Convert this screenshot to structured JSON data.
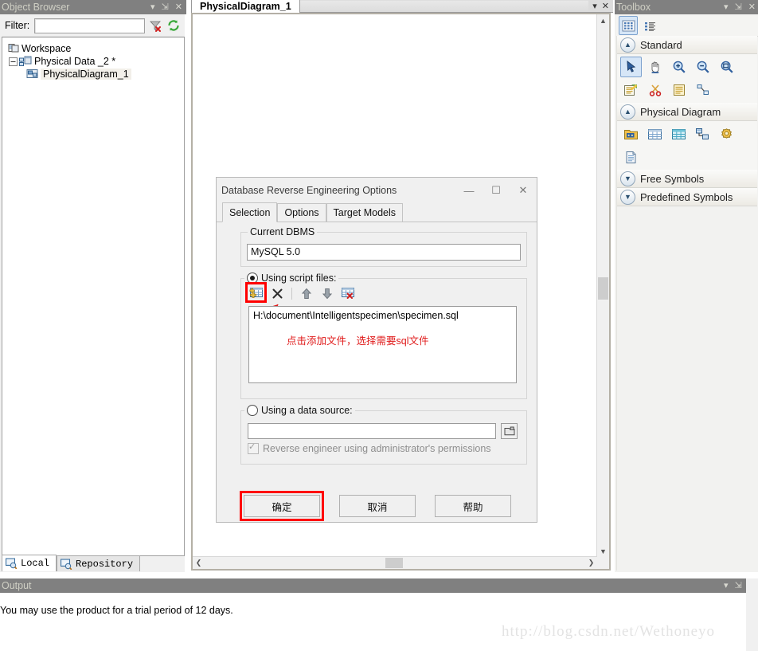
{
  "object_browser": {
    "title": "Object Browser",
    "header_buttons": [
      "dropdown-icon",
      "pin-icon",
      "close-icon"
    ],
    "filter_label": "Filter:",
    "filter_value": "",
    "filter_placeholder": "",
    "clear_filter_icon": "clear-filter-icon",
    "refresh_icon": "refresh-icon",
    "tree": [
      {
        "label": "Workspace",
        "icon": "workspace-icon",
        "depth": 0,
        "selected": false
      },
      {
        "label": "Physical Data _2 *",
        "icon": "model-icon",
        "depth": 1,
        "selected": false
      },
      {
        "label": "PhysicalDiagram_1",
        "icon": "diagram-icon",
        "depth": 2,
        "selected": true
      }
    ],
    "tabs": [
      {
        "label": "Local",
        "icon": "local-icon",
        "active": true
      },
      {
        "label": "Repository",
        "icon": "repository-icon",
        "active": false
      }
    ]
  },
  "diagram_area": {
    "tab_label": "PhysicalDiagram_1",
    "tab_buttons": [
      "tab-list-icon",
      "close-icon"
    ],
    "scroll": {
      "v_up": "▲",
      "v_down": "▼",
      "h_left": "❮",
      "h_right": "❯"
    }
  },
  "toolbox": {
    "title": "Toolbox",
    "header_buttons": [
      "dropdown-icon",
      "pin-icon",
      "close-icon"
    ],
    "view_modes": [
      {
        "name": "grid-view-icon",
        "active": true
      },
      {
        "name": "list-view-icon",
        "active": false
      }
    ],
    "sections": [
      {
        "label": "Standard",
        "expanded": true,
        "chevron": "▲",
        "items": [
          {
            "name": "pointer-icon",
            "active": true
          },
          {
            "name": "grabber-hand-icon",
            "active": false
          },
          {
            "name": "zoom-in-icon",
            "active": false
          },
          {
            "name": "zoom-out-icon",
            "active": false
          },
          {
            "name": "zoom-area-icon",
            "active": false
          },
          {
            "name": "properties-icon",
            "active": false
          },
          {
            "name": "delete-scissors-icon",
            "active": false
          },
          {
            "name": "note-icon",
            "active": false
          },
          {
            "name": "link-icon",
            "active": false
          }
        ]
      },
      {
        "label": "Physical Diagram",
        "expanded": true,
        "chevron": "▲",
        "items": [
          {
            "name": "package-icon",
            "active": false
          },
          {
            "name": "table-icon",
            "active": false
          },
          {
            "name": "view-icon",
            "active": false
          },
          {
            "name": "reference-icon",
            "active": false
          },
          {
            "name": "procedure-icon",
            "active": false
          },
          {
            "name": "file-icon",
            "active": false
          }
        ]
      },
      {
        "label": "Free Symbols",
        "expanded": false,
        "chevron": "▼",
        "items": []
      },
      {
        "label": "Predefined Symbols",
        "expanded": false,
        "chevron": "▼",
        "items": []
      }
    ]
  },
  "output": {
    "title": "Output",
    "header_buttons": [
      "dropdown-icon",
      "pin-icon",
      "close-icon"
    ],
    "text": "You may use the product for a trial period of 12 days."
  },
  "watermark": "http://blog.csdn.net/Wethoneyo",
  "dialog": {
    "title": "Database Reverse Engineering Options",
    "window_buttons": {
      "minimize": "—",
      "maximize": "☐",
      "close": "✕"
    },
    "tabs": [
      {
        "label": "Selection",
        "active": true
      },
      {
        "label": "Options",
        "active": false
      },
      {
        "label": "Target Models",
        "active": false
      }
    ],
    "current_dbms": {
      "caption": "Current DBMS",
      "value": "MySQL 5.0"
    },
    "script_files": {
      "caption": "Using script files:",
      "selected": true,
      "toolbar": [
        {
          "name": "add-file-icon",
          "highlighted": true
        },
        {
          "name": "remove-file-icon",
          "highlighted": false
        },
        {
          "name": "move-up-icon",
          "highlighted": false
        },
        {
          "name": "move-down-icon",
          "highlighted": false
        },
        {
          "name": "clear-all-icon",
          "highlighted": false
        }
      ],
      "files": [
        "H:\\document\\Intelligentspecimen\\specimen.sql"
      ],
      "annotation": "点击添加文件，选择需要sql文件",
      "annotation_color": "#e01b1b"
    },
    "data_source": {
      "caption": "Using a data source:",
      "selected": false,
      "value": "",
      "browse_icon": "datasource-browse-icon",
      "checkbox_label": "Reverse engineer using administrator's permissions",
      "checkbox_checked": true,
      "checkbox_disabled": true
    },
    "buttons": [
      {
        "label": "确定",
        "name": "ok-button",
        "highlighted": true
      },
      {
        "label": "取消",
        "name": "cancel-button",
        "highlighted": false
      },
      {
        "label": "帮助",
        "name": "help-button",
        "highlighted": false
      }
    ]
  },
  "colors": {
    "panel_header_bg": "#808080",
    "panel_header_fg": "#cfcfc4",
    "highlight_red": "#ff0000",
    "accent_blue": "#d6e6f7"
  }
}
